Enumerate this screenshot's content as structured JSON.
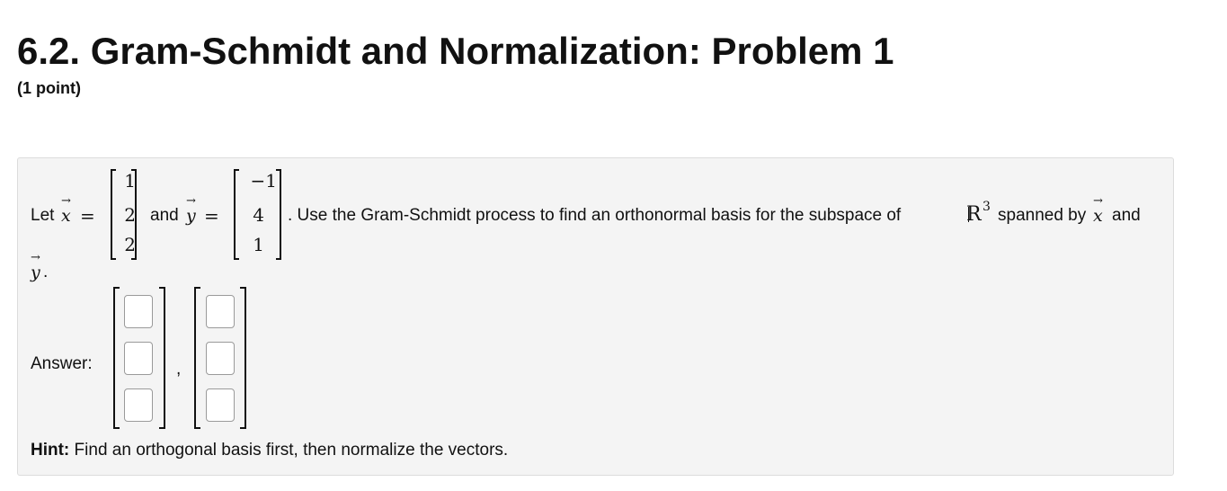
{
  "header": {
    "title": "6.2. Gram-Schmidt and Normalization: Problem 1",
    "points": "(1 point)"
  },
  "problem": {
    "let": "Let",
    "x_var": "x",
    "y_var": "y",
    "arrow": "→",
    "equals": "=",
    "and": "and",
    "x_vector": [
      "1",
      "2",
      "2"
    ],
    "y_vector": [
      "−1",
      "4",
      "1"
    ],
    "sentence_part1": ". Use the Gram-Schmidt process to find an orthonormal basis for the subspace of",
    "space_symbol": "R",
    "space_exponent": "3",
    "sentence_part2": "spanned by",
    "sentence_and": "and",
    "period": "."
  },
  "answer": {
    "label": "Answer:",
    "separator": ",",
    "vector1": [
      "",
      "",
      ""
    ],
    "vector2": [
      "",
      "",
      ""
    ]
  },
  "hint": {
    "label": "Hint:",
    "text": "Find an orthogonal basis first, then normalize the vectors."
  }
}
